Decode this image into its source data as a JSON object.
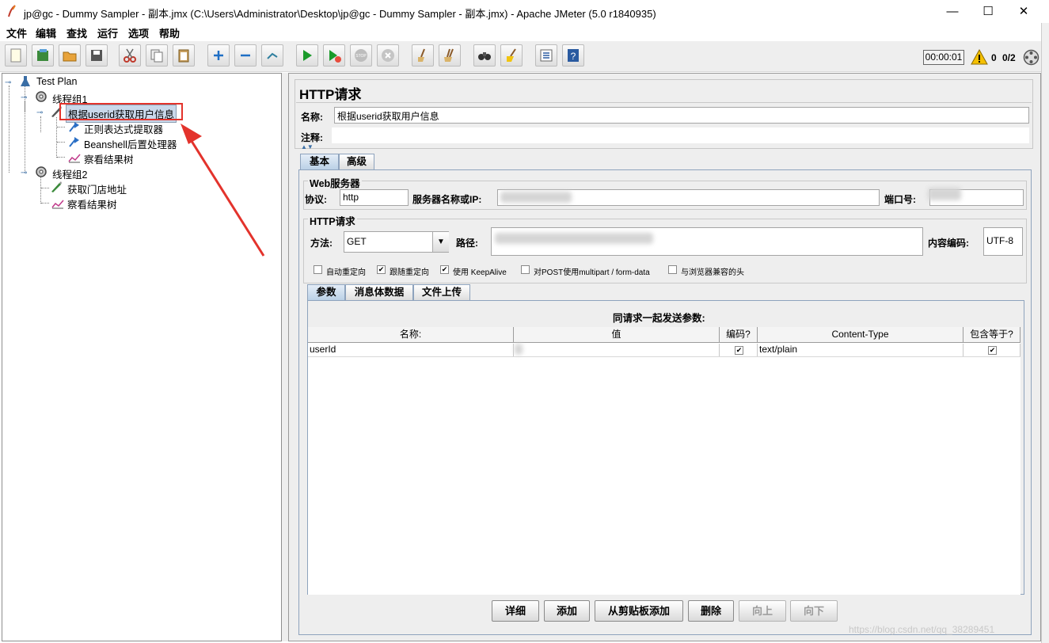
{
  "window": {
    "title": "jp@gc - Dummy Sampler - 副本.jmx (C:\\Users\\Administrator\\Desktop\\jp@gc - Dummy Sampler - 副本.jmx) - Apache JMeter (5.0 r1840935)",
    "minimize": "—",
    "maximize": "☐",
    "close": "✕"
  },
  "menu": [
    "文件",
    "编辑",
    "查找",
    "运行",
    "选项",
    "帮助"
  ],
  "toolbar": {
    "icons": [
      "new-icon",
      "templates-icon",
      "open-icon",
      "save-icon",
      "cut-icon",
      "copy-icon",
      "paste-icon",
      "expand-icon",
      "collapse-icon",
      "toggle-icon",
      "start-icon",
      "start-no-pause-icon",
      "stop-icon",
      "shutdown-icon",
      "clear-icon",
      "clear-all-icon",
      "search-icon",
      "reset-search-icon",
      "function-helper-icon",
      "help-icon"
    ],
    "timer": "00:00:01",
    "warning_count": "0",
    "threads": "0/2"
  },
  "tree": {
    "test_plan": "Test Plan",
    "group1": "线程组1",
    "request": "根据userid获取用户信息",
    "regex": "正则表达式提取器",
    "beanshell": "Beanshell后置处理器",
    "results1": "察看结果树",
    "group2": "线程组2",
    "store": "获取门店地址",
    "results2": "察看结果树"
  },
  "panel": {
    "title": "HTTP请求",
    "name_label": "名称:",
    "name_value": "根据userid获取用户信息",
    "comment_label": "注释:",
    "tabs": [
      "基本",
      "高级"
    ],
    "web_server": {
      "legend": "Web服务器",
      "protocol_label": "协议:",
      "protocol_value": "http",
      "server_label": "服务器名称或IP:",
      "port_label": "端口号:"
    },
    "http": {
      "legend": "HTTP请求",
      "method_label": "方法:",
      "method_value": "GET",
      "path_label": "路径:",
      "encoding_label": "内容编码:",
      "encoding_value": "UTF-8"
    },
    "options": [
      {
        "label": "自动重定向",
        "checked": false
      },
      {
        "label": "跟随重定向",
        "checked": true
      },
      {
        "label": "使用 KeepAlive",
        "checked": true
      },
      {
        "label": "对POST使用multipart / form-data",
        "checked": false
      },
      {
        "label": "与浏览器兼容的头",
        "checked": false
      }
    ],
    "subtabs": [
      "参数",
      "消息体数据",
      "文件上传"
    ],
    "params": {
      "heading": "同请求一起发送参数:",
      "columns": [
        "名称:",
        "值",
        "编码?",
        "Content-Type",
        "包含等于?"
      ],
      "rows": [
        {
          "name": "userId",
          "value": "",
          "encode": "✔",
          "content_type": "text/plain",
          "include_equals": "✔"
        }
      ]
    },
    "buttons": {
      "detail": "详细",
      "add": "添加",
      "add_clipboard": "从剪贴板添加",
      "delete": "删除",
      "up": "向上",
      "down": "向下"
    }
  },
  "watermark": "https://blog.csdn.net/qq_38289451"
}
